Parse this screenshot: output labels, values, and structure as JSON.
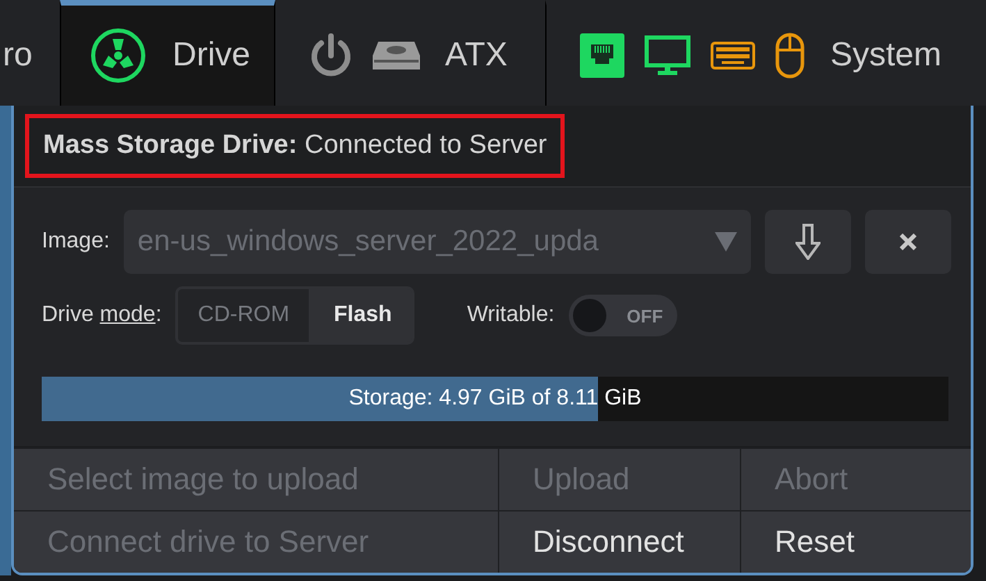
{
  "tabs": [
    {
      "label": "ro",
      "selected": false
    },
    {
      "label": "Drive",
      "selected": true,
      "icons": [
        {
          "kind": "drive"
        }
      ]
    },
    {
      "label": "ATX",
      "selected": false,
      "icons": [
        {
          "kind": "power"
        },
        {
          "kind": "hdd"
        }
      ]
    },
    {
      "label": "System",
      "selected": false,
      "icons": [
        {
          "kind": "ethernet",
          "color": "#1ed760"
        },
        {
          "kind": "monitor",
          "color": "#1ed760"
        },
        {
          "kind": "keyboard",
          "color": "#e8960c"
        },
        {
          "kind": "mouse",
          "color": "#e8960c"
        }
      ]
    }
  ],
  "panel": {
    "title": "Mass Storage Drive:",
    "status": "Connected to Server",
    "highlighted": true,
    "image": {
      "label": "Image:",
      "value": "en-us_windows_server_2022_upda",
      "disabled": true
    },
    "mode": {
      "label_before": "Drive ",
      "label_key": "mode",
      "label_after": ":",
      "options": [
        {
          "label": "CD-ROM",
          "selected": false
        },
        {
          "label": "Flash",
          "selected": true
        }
      ]
    },
    "writable": {
      "label": "Writable:",
      "on": false,
      "text": "OFF"
    },
    "storage": {
      "text": "Storage: 4.97 GiB of 8.11 GiB",
      "level": 0.614
    },
    "buttons": [
      {
        "label": "Select image to upload",
        "disabled": true
      },
      {
        "label": "Upload",
        "disabled": true
      },
      {
        "label": "Abort",
        "disabled": true
      },
      {
        "label": "Connect drive to Server",
        "disabled": true
      },
      {
        "label": "Disconnect",
        "disabled": false
      },
      {
        "label": "Reset",
        "disabled": false
      }
    ]
  }
}
